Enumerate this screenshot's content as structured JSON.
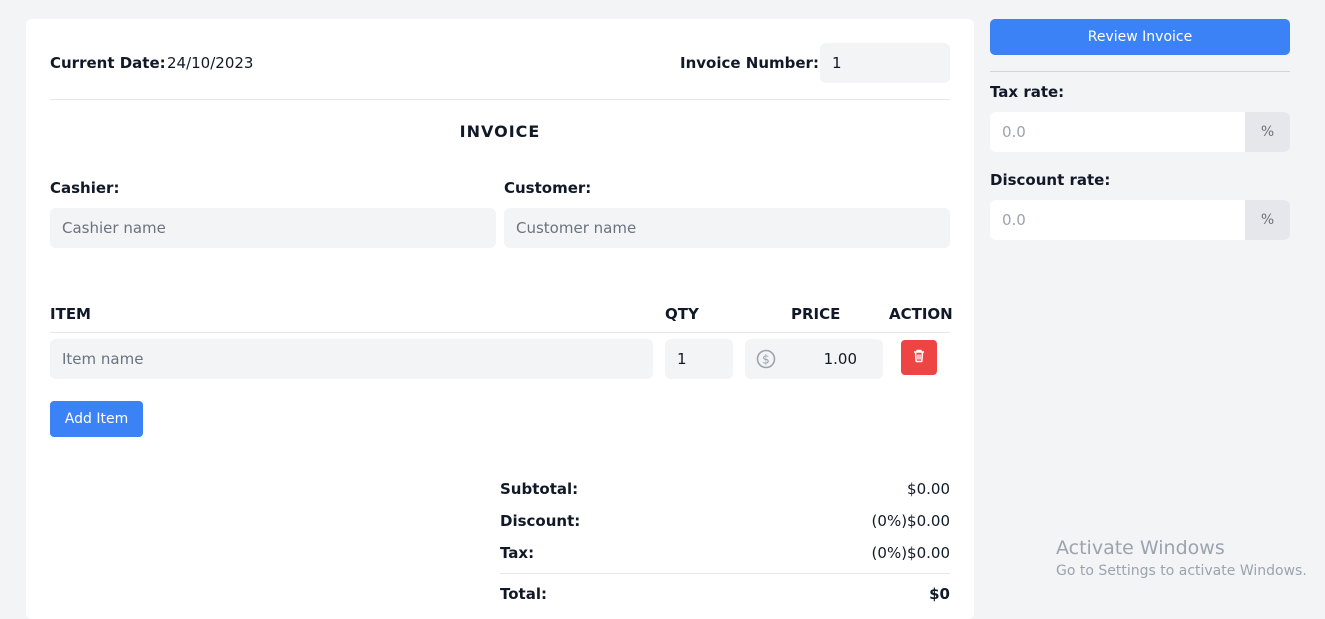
{
  "header": {
    "current_date_label": "Current Date:",
    "current_date_value": "24/10/2023",
    "invoice_number_label": "Invoice Number:",
    "invoice_number_value": "1"
  },
  "title": "INVOICE",
  "cashier": {
    "label": "Cashier:",
    "placeholder": "Cashier name"
  },
  "customer": {
    "label": "Customer:",
    "placeholder": "Customer name"
  },
  "table": {
    "headers": {
      "item": "ITEM",
      "qty": "QTY",
      "price": "PRICE",
      "action": "ACTION"
    },
    "rows": [
      {
        "item_placeholder": "Item name",
        "qty": "1",
        "price": "1.00",
        "currency_icon": "dollar-circle-icon",
        "delete_icon": "trash-icon"
      }
    ]
  },
  "add_item_label": "Add Item",
  "summary": {
    "subtotal_label": "Subtotal:",
    "subtotal_value": "$0.00",
    "discount_label": "Discount:",
    "discount_value": "(0%)$0.00",
    "tax_label": "Tax:",
    "tax_value": "(0%)$0.00",
    "total_label": "Total:",
    "total_value": "$0"
  },
  "sidebar": {
    "review_label": "Review Invoice",
    "tax_rate_label": "Tax rate:",
    "tax_rate_placeholder": "0.0",
    "tax_rate_unit": "%",
    "discount_rate_label": "Discount rate:",
    "discount_rate_placeholder": "0.0",
    "discount_rate_unit": "%"
  },
  "watermark": {
    "title": "Activate Windows",
    "subtitle": "Go to Settings to activate Windows."
  },
  "colors": {
    "primary": "#3b82f6",
    "danger": "#ef4444",
    "background": "#f3f4f6"
  }
}
